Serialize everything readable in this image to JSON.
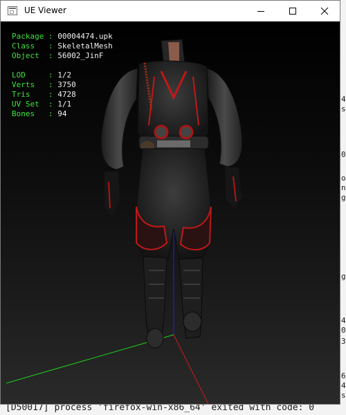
{
  "window": {
    "title": "UE Viewer",
    "controls": [
      "minimize",
      "maximize",
      "close"
    ]
  },
  "info_panel": {
    "group1": [
      {
        "label": "Package",
        "value": "00004474.upk"
      },
      {
        "label": "Class",
        "value": "SkeletalMesh"
      },
      {
        "label": "Object",
        "value": "56002_JinF"
      }
    ],
    "group2": [
      {
        "label": "LOD",
        "value": "1/2"
      },
      {
        "label": "Verts",
        "value": "3750"
      },
      {
        "label": "Tris",
        "value": "4728"
      },
      {
        "label": "UV Set",
        "value": "1/1"
      },
      {
        "label": "Bones",
        "value": "94"
      }
    ]
  },
  "background_console": {
    "right_edge_chars": [
      "4",
      "s",
      "0",
      "o",
      "n",
      "g",
      "g",
      "4",
      "0",
      "3",
      "6",
      "4",
      "s"
    ],
    "bottom_line": "[D50017] process 'firefox-win-x86_64' exited with code: 0"
  },
  "colors": {
    "label_green": "#3fe33f",
    "value_white": "#f2f2f2",
    "axis_x": "#d11a1a",
    "axis_y": "#1fd11f",
    "axis_z": "#2222e0"
  },
  "icons": [
    "app-window-icon",
    "minimize-icon",
    "maximize-icon",
    "close-icon"
  ]
}
